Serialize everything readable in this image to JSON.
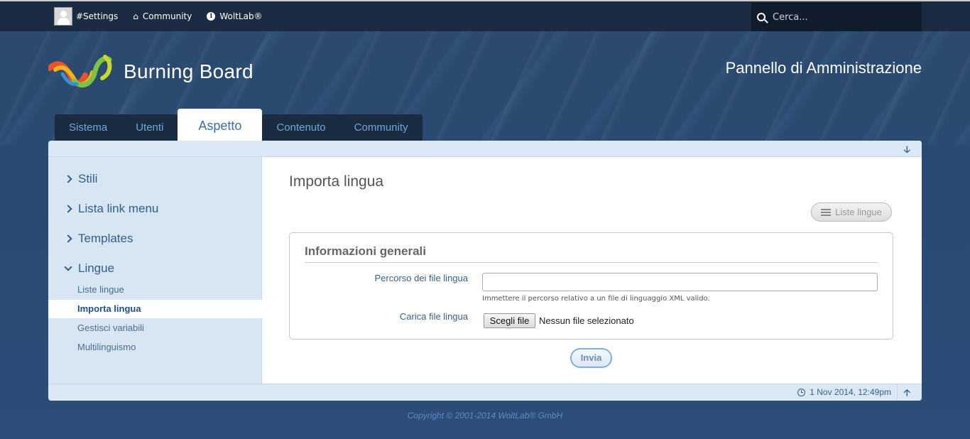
{
  "topbar": {
    "user_label": "#Settings",
    "community_label": "Community",
    "woltlab_label": "WoltLab®",
    "search_placeholder": "Cerca..."
  },
  "header": {
    "logo_text": "Burning Board",
    "acp_title": "Pannello di Amministrazione"
  },
  "tabs": [
    {
      "label": "Sistema"
    },
    {
      "label": "Utenti"
    },
    {
      "label": "Aspetto"
    },
    {
      "label": "Contenuto"
    },
    {
      "label": "Community"
    }
  ],
  "sidebar": {
    "sections": [
      {
        "label": "Stili"
      },
      {
        "label": "Lista link menu"
      },
      {
        "label": "Templates"
      },
      {
        "label": "Lingue"
      }
    ],
    "items": [
      {
        "label": "Liste lingue"
      },
      {
        "label": "Importa lingua"
      },
      {
        "label": "Gestisci variabili"
      },
      {
        "label": "Multilinguismo"
      }
    ]
  },
  "main": {
    "title": "Importa lingua",
    "list_button": "Liste lingue",
    "fieldset_legend": "Informazioni generali",
    "path_label": "Percorso dei file lingua",
    "path_value": "",
    "path_hint": "Immettere il percorso relativo a un file di linguaggio XML valido.",
    "upload_label": "Carica file lingua",
    "file_button": "Scegli file",
    "file_status": "Nessun file selezionato",
    "submit_label": "Invia"
  },
  "footer": {
    "time": "1 Nov 2014, 12:49pm",
    "copyright": "Copyright © 2001-2014 WoltLab® GmbH"
  },
  "colors": {
    "accent": "#2f5f8f",
    "topbar": "#1b2b42",
    "background": "#2b4a72"
  }
}
